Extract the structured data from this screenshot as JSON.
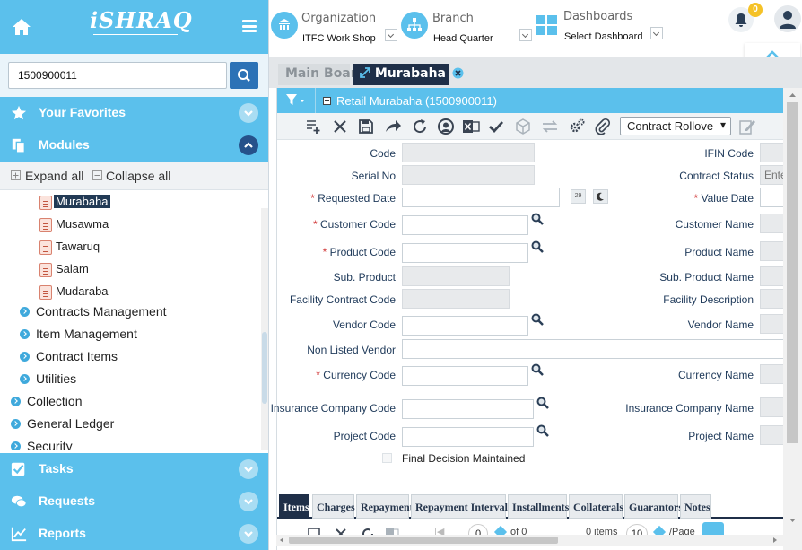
{
  "sidebar": {
    "logo": "iSHRAQ",
    "search": {
      "value": "1500900011"
    },
    "sections": {
      "favorites": "Your Favorites",
      "modules": "Modules",
      "tasks": "Tasks",
      "requests": "Requests",
      "reports": "Reports"
    },
    "expand_all": "Expand all",
    "collapse_all": "Collapse all",
    "leaves": [
      "Murabaha",
      "Musawma",
      "Tawaruq",
      "Salam",
      "Mudaraba"
    ],
    "subnodes": [
      "Contracts Management",
      "Item Management",
      "Contract Items",
      "Utilities"
    ],
    "nodes": [
      "Collection",
      "General Ledger",
      "Security"
    ]
  },
  "topbar": {
    "org_label": "Organization",
    "org_value": "ITFC Work Shop",
    "branch_label": "Branch",
    "branch_value": "Head Quarter",
    "dash_label": "Dashboards",
    "dash_value": "Select Dashboard",
    "notifications": "0"
  },
  "tabs": {
    "main": "Main Board",
    "current": "Murabaha"
  },
  "panel": {
    "title": "Retail Murabaha (1500900011)",
    "rollover_select": "Contract Rollove",
    "fields_left": {
      "code": "Code",
      "serial": "Serial No",
      "requested_date": "Requested Date",
      "customer_code": "Customer Code",
      "product_code": "Product Code",
      "sub_product": "Sub. Product",
      "facility_code": "Facility Contract Code",
      "vendor_code": "Vendor Code",
      "non_listed_vendor": "Non Listed Vendor",
      "currency_code": "Currency Code",
      "insurance_code": "Insurance Company Code",
      "project_code": "Project Code",
      "final_decision": "Final Decision Maintained"
    },
    "fields_right": {
      "ifin_code": "IFIN Code",
      "contract_status": "Contract Status",
      "contract_status_value": "Ente",
      "value_date": "Value Date",
      "customer_name": "Customer Name",
      "product_name": "Product Name",
      "sub_product_name": "Sub. Product Name",
      "facility_desc": "Facility Description",
      "vendor_name": "Vendor Name",
      "currency_name": "Currency Name",
      "insurance_name": "Insurance Company Name",
      "project_name": "Project Name"
    },
    "calendar_day": "29",
    "bottom_tabs": [
      "Items",
      "Charges",
      "Repayment",
      "Repayment Intervals",
      "Installments",
      "Collaterals",
      "Guarantors",
      "Notes"
    ],
    "pager": {
      "page": "0",
      "of": "of 0",
      "items": "0 items",
      "size": "10",
      "per_page": "/Page"
    }
  },
  "colors": {
    "accent": "#5bc0ec",
    "dark": "#1f2f48",
    "required": "#d23a3a"
  }
}
